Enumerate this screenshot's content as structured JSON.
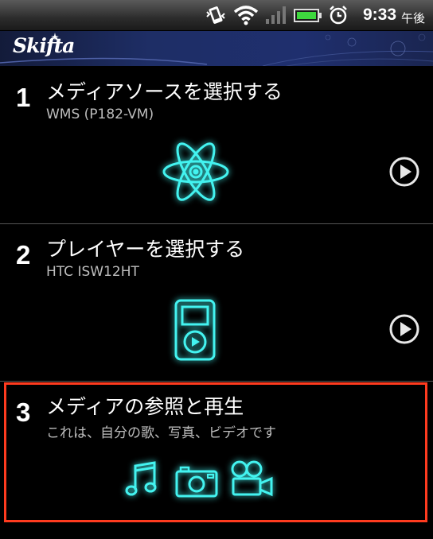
{
  "status_bar": {
    "time": "9:33",
    "ampm": "午後",
    "icons": [
      "vibrate-icon",
      "wifi-icon",
      "signal-icon",
      "battery-icon",
      "alarm-icon"
    ]
  },
  "header": {
    "logo_text": "Skifta"
  },
  "steps": [
    {
      "number": "1",
      "title": "メディアソースを選択する",
      "subtitle": "WMS (P182-VM)",
      "icon": "atom-icon"
    },
    {
      "number": "2",
      "title": "プレイヤーを選択する",
      "subtitle": "HTC ISW12HT",
      "icon": "media-player-icon"
    },
    {
      "number": "3",
      "title": "メディアの参照と再生",
      "subtitle": "これは、自分の歌、写真、ビデオです",
      "icons": [
        "music-note-icon",
        "camera-icon",
        "video-camera-icon"
      ]
    }
  ],
  "colors": {
    "glow": "#43f3f0",
    "highlight_border": "#ff3b1f",
    "header": "#1f2f6e"
  }
}
